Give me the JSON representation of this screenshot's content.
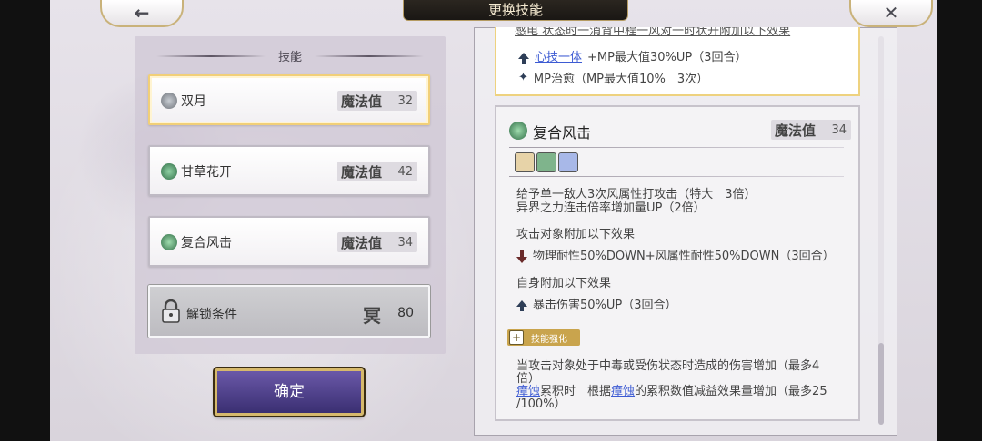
{
  "header": {
    "title": "更换技能",
    "back_icon": "←",
    "close_icon": "✕"
  },
  "left": {
    "heading": "技能",
    "skills": [
      {
        "name": "双月",
        "mp_label": "魔法值",
        "mp": "32",
        "icon": "wind-skill-icon",
        "color": "#9aa0a8",
        "selected": true
      },
      {
        "name": "甘草花开",
        "mp_label": "魔法值",
        "mp": "42",
        "icon": "leaf-skill-icon",
        "color": "#3f8f5c",
        "selected": false
      },
      {
        "name": "复合风击",
        "mp_label": "魔法值",
        "mp": "34",
        "icon": "wind-skill-icon",
        "color": "#3f8f5c",
        "selected": false
      }
    ],
    "locked": {
      "name": "解锁条件",
      "icon_text": "冥",
      "value": "80"
    },
    "confirm_label": "确定"
  },
  "top_box": {
    "cut_text": "感电 状态时一消背中程一风对一时状开附加以下效果",
    "rows": [
      {
        "link": "心技一体",
        "text": "+MP最大值30%UP（3回合）"
      },
      {
        "text": "MP治愈（MP最大值10%　3次）"
      }
    ]
  },
  "detail": {
    "name": "复合风击",
    "mp_label": "魔法值",
    "mp": "34",
    "effect_lines": [
      "给予单一敌人3次风属性打攻击（特大　3倍）",
      "异界之力连击倍率增加量UP（2倍）"
    ],
    "target_heading": "攻击对象附加以下效果",
    "target_effect": "物理耐性50%DOWN+风属性耐性50%DOWN（3回合）",
    "self_heading": "自身附加以下效果",
    "self_effect": "暴击伤害50%UP（3回合）",
    "enhance_badge": "技能强化",
    "enhance_line1": "当攻击对象处于中毒或受伤状态时造成的伤害增加（最多4",
    "enhance_line2": "倍）",
    "enhance_link1": "瘴蚀",
    "enhance_mid1": "累积时　根据",
    "enhance_link2": "瘴蚀",
    "enhance_mid2": "的累积数值减益效果量增加（最多25",
    "enhance_line4": "/100%）"
  }
}
